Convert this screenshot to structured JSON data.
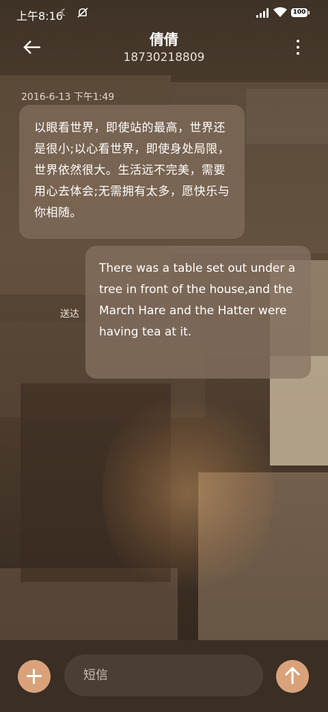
{
  "status_bar": {
    "time": "上午8:16",
    "battery": "100"
  },
  "header": {
    "contact_name": "倩倩",
    "phone_number": "18730218809"
  },
  "conversation": {
    "timestamp": "2016-6-13 下午1:49",
    "messages": [
      {
        "direction": "received",
        "text": "以眼看世界，即使站的最高，世界还是很小;以心看世界，即使身处局限，世界依然很大。生活远不完美，需要用心去体会;无需拥有太多，愿快乐与你相随。"
      },
      {
        "direction": "sent",
        "text": "There was a table set out under a tree in front of the house,and the March Hare and the Hatter were having tea at it.",
        "status": "送达"
      }
    ]
  },
  "composer": {
    "placeholder": "短信"
  },
  "icons": {
    "back": "back-arrow-icon",
    "more": "more-vertical-icon",
    "attach": "plus-icon",
    "send": "send-arrow-icon",
    "moon": "moon-icon",
    "mute": "mute-icon",
    "signal": "signal-icon",
    "wifi": "wifi-icon",
    "battery": "battery-icon"
  },
  "colors": {
    "accent": "#d9a27a",
    "bubble": "#826e5c",
    "bottom_bar": "#3a2e25"
  }
}
